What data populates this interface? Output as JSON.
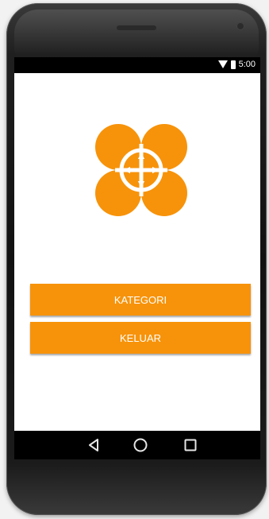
{
  "status_bar": {
    "time": "5:00",
    "icons": [
      "wifi-icon",
      "battery-icon"
    ]
  },
  "main": {
    "logo_icon": "clover-crosshair-logo",
    "buttons": [
      {
        "label": "KATEGORI"
      },
      {
        "label": "KELUAR"
      }
    ]
  },
  "nav_bar": {
    "icons": [
      "back-icon",
      "home-icon",
      "recents-icon"
    ]
  },
  "colors": {
    "accent": "#f7930a",
    "screen_bg": "#ffffff",
    "bars": "#000000"
  }
}
